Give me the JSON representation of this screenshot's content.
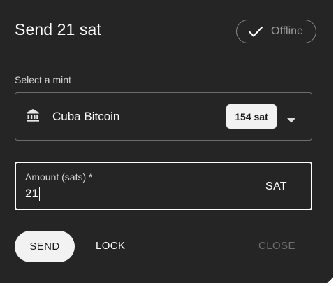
{
  "dialog": {
    "title": "Send 21 sat",
    "status_chip": {
      "label": "Offline",
      "icon": "check-icon"
    }
  },
  "mint": {
    "label": "Select a mint",
    "selected_name": "Cuba Bitcoin",
    "icon": "bank-icon",
    "balance": "154 sat"
  },
  "amount": {
    "label": "Amount (sats) *",
    "value": "21",
    "unit": "SAT"
  },
  "actions": {
    "send": "SEND",
    "lock": "LOCK",
    "close": "CLOSE"
  },
  "colors": {
    "background": "#252525",
    "text": "#ffffff",
    "muted": "#6e6e6e",
    "button_bg": "#f2f2f2"
  }
}
